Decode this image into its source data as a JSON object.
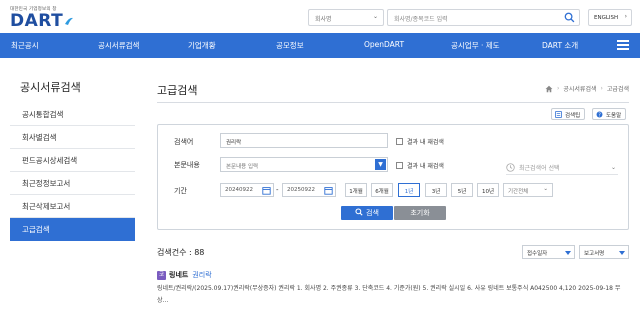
{
  "header": {
    "logo_tagline": "대한민국 기업정보의 창",
    "logo_text": "DART",
    "company_select": "회사명",
    "search_placeholder": "회사명/종목코드 입력",
    "language": "ENGLISH"
  },
  "nav": {
    "items": [
      "최근공시",
      "공시서류검색",
      "기업개황",
      "공모정보",
      "OpenDART",
      "공시업무 · 제도",
      "DART 소개"
    ]
  },
  "sidebar": {
    "title": "공시서류검색",
    "items": [
      {
        "label": "공시통합검색",
        "active": false
      },
      {
        "label": "회사별검색",
        "active": false
      },
      {
        "label": "펀드공시상세검색",
        "active": false
      },
      {
        "label": "최근정정보고서",
        "active": false
      },
      {
        "label": "최근삭제보고서",
        "active": false
      },
      {
        "label": "고급검색",
        "active": true
      }
    ]
  },
  "page": {
    "title": "고급검색",
    "breadcrumb": [
      "공시서류검색",
      "고급검색"
    ],
    "tools": {
      "tip": "검색팁",
      "help": "도움말"
    }
  },
  "form": {
    "company_label": "검색어",
    "company_value": "권리락",
    "in_result_1": "결과 내 재검색",
    "body_label": "본문내용",
    "body_placeholder": "본문내용 입력",
    "in_result_2": "결과 내 재검색",
    "recent_label": "최근검색어 선택",
    "period_label": "기간",
    "date_from": "20240922",
    "date_to": "20250922",
    "periods": [
      "1개월",
      "6개월",
      "1년",
      "3년",
      "5년",
      "10년"
    ],
    "selected_period": "1년",
    "all_period": "기간전체",
    "search_button": "검색",
    "reset_button": "초기화"
  },
  "results": {
    "count_label": "검색건수 : 88",
    "sort_label": "접수일자",
    "view_label": "보고서명",
    "items": [
      {
        "badge": "코",
        "company": "링네트",
        "report": "권리락",
        "detail": "링네트/권리락/(2025.09.17)권리락(무상증자) 권리락 1. 회사명 2. 주권종류 3. 단축코드 4. 기준가(원) 5. 권리락 실시일 6. 사유 링네트 보통주식 A042500 4,120 2025-09-18 무상..."
      }
    ]
  },
  "colors": {
    "primary": "#2f6fd3",
    "logo": "#1f4ea0",
    "badge": "#7a5cc0",
    "reset": "#8a8f96"
  }
}
